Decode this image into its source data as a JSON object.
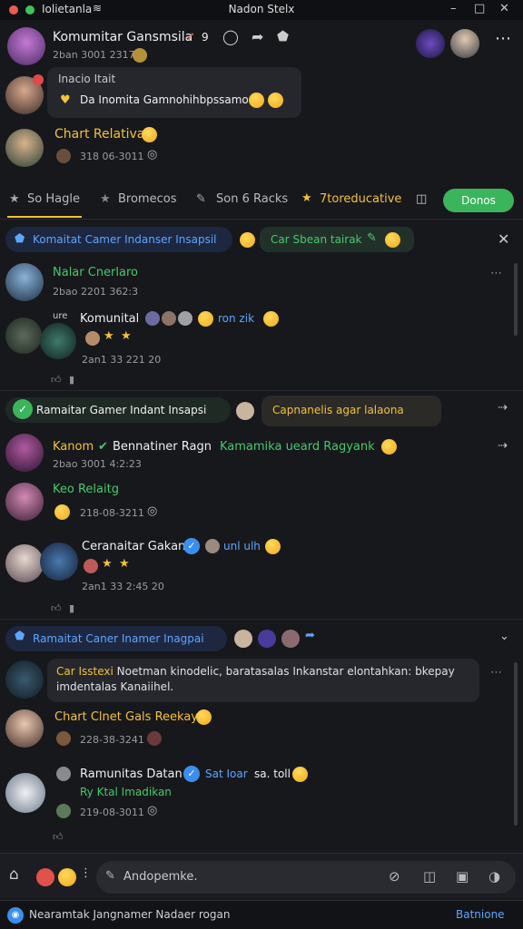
{
  "titlebar": {
    "left_label": "Iolietanla",
    "center_title": "Nadon Stelx",
    "window_controls": [
      "–",
      "□",
      "✕"
    ]
  },
  "top_chat": {
    "title": "Komumitar Gansmsila",
    "count": "9",
    "timestamp": "2ban 3001 2317",
    "reply_label": "Inacio Itait",
    "reply_text": "Da Inomita Gamnohihbpssamo",
    "chart_label": "Chart Relativa",
    "chart_time": "318 06-3011"
  },
  "tabs": [
    {
      "label": "So Hagle",
      "icon": "star-icon"
    },
    {
      "label": "Bromecos",
      "icon": "star-icon"
    },
    {
      "label": "Son 6 Racks",
      "icon": "pin-icon"
    },
    {
      "label": "7toreducative",
      "icon": "star-icon"
    }
  ],
  "see_all_label": "Donos",
  "banner1": {
    "text": "Komaitat Camer Indanser Insapsil",
    "tag": "Car Sbean tairak"
  },
  "messages1": [
    {
      "name": "Nalar Cnerlaro",
      "time": "2bao 2201 362:3"
    },
    {
      "name": "Komunital",
      "extra": "ron zik",
      "time": "2an1 33 221  20",
      "badge": "ure"
    }
  ],
  "banner2": {
    "text": "Ramaitar Gamer Indant Insapsi",
    "tag": "Capnanelis agar lalaona"
  },
  "messages2": [
    {
      "name": "Kanom",
      "name2": "Bennatiner Ragn",
      "tail": "Kamamika ueard Ragyank",
      "time": "2bao 3001 4:2:23"
    },
    {
      "name": "Keo Relaitg",
      "time": "218-08-3211"
    },
    {
      "name": "Ceranaitar Gakan",
      "extra": "unl ulh",
      "time": "2an1 33 2:45  20"
    }
  ],
  "banner3": {
    "text": "Ramaitat Caner Inamer Inagpai"
  },
  "messages3": [
    {
      "name": "Car Isstexi",
      "text": "Noetman kinodelic, baratasalas Inkanstar elontahkan: bkepay imdentalas Kanaiihel."
    },
    {
      "name": "Chart Clnet Gals Reekay",
      "time": "228-38-3241"
    },
    {
      "name": "Ramunitas Datan",
      "extra": "Sat Ioar",
      "extra2": "sa. toll",
      "sub": "Ry Ktal Imadikan",
      "time": "219-08-3011"
    }
  ],
  "composer": {
    "placeholder": "Andopemke."
  },
  "statusbar": {
    "text": "Nearamtak Jangnamer Nadaer rogan",
    "right": "Batnione"
  },
  "colors": {
    "accent_green": "#3bb55c",
    "accent_blue": "#5da6ff",
    "name_yellow": "#f3c13a"
  }
}
